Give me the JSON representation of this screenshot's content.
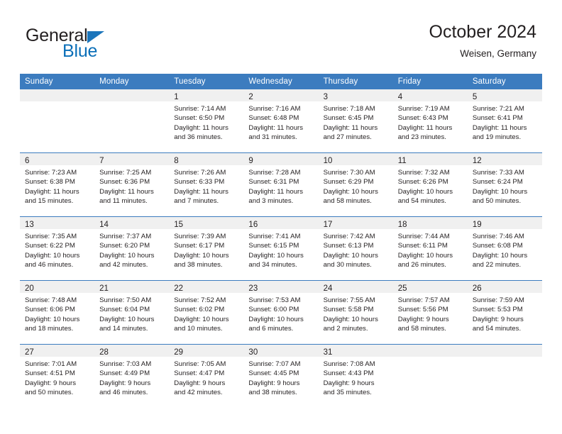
{
  "brand": {
    "name_part1": "General",
    "name_part2": "Blue",
    "accent_color": "#1b75bb",
    "text_color": "#231f20"
  },
  "header": {
    "title": "October 2024",
    "subtitle": "Weisen, Germany",
    "band_color": "#3c7cbf",
    "daynum_band_color": "#f0f0f0"
  },
  "weekday_headers": [
    "Sunday",
    "Monday",
    "Tuesday",
    "Wednesday",
    "Thursday",
    "Friday",
    "Saturday"
  ],
  "labels": {
    "sunrise_prefix": "Sunrise:",
    "sunset_prefix": "Sunset:",
    "daylight_prefix": "Daylight:"
  },
  "weeks": [
    [
      {
        "day": "",
        "empty": true,
        "sunrise": "",
        "sunset": "",
        "daylight_line1": "",
        "daylight_line2": ""
      },
      {
        "day": "",
        "empty": true,
        "sunrise": "",
        "sunset": "",
        "daylight_line1": "",
        "daylight_line2": ""
      },
      {
        "day": "1",
        "empty": false,
        "sunrise": "Sunrise: 7:14 AM",
        "sunset": "Sunset: 6:50 PM",
        "daylight_line1": "Daylight: 11 hours",
        "daylight_line2": "and 36 minutes."
      },
      {
        "day": "2",
        "empty": false,
        "sunrise": "Sunrise: 7:16 AM",
        "sunset": "Sunset: 6:48 PM",
        "daylight_line1": "Daylight: 11 hours",
        "daylight_line2": "and 31 minutes."
      },
      {
        "day": "3",
        "empty": false,
        "sunrise": "Sunrise: 7:18 AM",
        "sunset": "Sunset: 6:45 PM",
        "daylight_line1": "Daylight: 11 hours",
        "daylight_line2": "and 27 minutes."
      },
      {
        "day": "4",
        "empty": false,
        "sunrise": "Sunrise: 7:19 AM",
        "sunset": "Sunset: 6:43 PM",
        "daylight_line1": "Daylight: 11 hours",
        "daylight_line2": "and 23 minutes."
      },
      {
        "day": "5",
        "empty": false,
        "sunrise": "Sunrise: 7:21 AM",
        "sunset": "Sunset: 6:41 PM",
        "daylight_line1": "Daylight: 11 hours",
        "daylight_line2": "and 19 minutes."
      }
    ],
    [
      {
        "day": "6",
        "empty": false,
        "sunrise": "Sunrise: 7:23 AM",
        "sunset": "Sunset: 6:38 PM",
        "daylight_line1": "Daylight: 11 hours",
        "daylight_line2": "and 15 minutes."
      },
      {
        "day": "7",
        "empty": false,
        "sunrise": "Sunrise: 7:25 AM",
        "sunset": "Sunset: 6:36 PM",
        "daylight_line1": "Daylight: 11 hours",
        "daylight_line2": "and 11 minutes."
      },
      {
        "day": "8",
        "empty": false,
        "sunrise": "Sunrise: 7:26 AM",
        "sunset": "Sunset: 6:33 PM",
        "daylight_line1": "Daylight: 11 hours",
        "daylight_line2": "and 7 minutes."
      },
      {
        "day": "9",
        "empty": false,
        "sunrise": "Sunrise: 7:28 AM",
        "sunset": "Sunset: 6:31 PM",
        "daylight_line1": "Daylight: 11 hours",
        "daylight_line2": "and 3 minutes."
      },
      {
        "day": "10",
        "empty": false,
        "sunrise": "Sunrise: 7:30 AM",
        "sunset": "Sunset: 6:29 PM",
        "daylight_line1": "Daylight: 10 hours",
        "daylight_line2": "and 58 minutes."
      },
      {
        "day": "11",
        "empty": false,
        "sunrise": "Sunrise: 7:32 AM",
        "sunset": "Sunset: 6:26 PM",
        "daylight_line1": "Daylight: 10 hours",
        "daylight_line2": "and 54 minutes."
      },
      {
        "day": "12",
        "empty": false,
        "sunrise": "Sunrise: 7:33 AM",
        "sunset": "Sunset: 6:24 PM",
        "daylight_line1": "Daylight: 10 hours",
        "daylight_line2": "and 50 minutes."
      }
    ],
    [
      {
        "day": "13",
        "empty": false,
        "sunrise": "Sunrise: 7:35 AM",
        "sunset": "Sunset: 6:22 PM",
        "daylight_line1": "Daylight: 10 hours",
        "daylight_line2": "and 46 minutes."
      },
      {
        "day": "14",
        "empty": false,
        "sunrise": "Sunrise: 7:37 AM",
        "sunset": "Sunset: 6:20 PM",
        "daylight_line1": "Daylight: 10 hours",
        "daylight_line2": "and 42 minutes."
      },
      {
        "day": "15",
        "empty": false,
        "sunrise": "Sunrise: 7:39 AM",
        "sunset": "Sunset: 6:17 PM",
        "daylight_line1": "Daylight: 10 hours",
        "daylight_line2": "and 38 minutes."
      },
      {
        "day": "16",
        "empty": false,
        "sunrise": "Sunrise: 7:41 AM",
        "sunset": "Sunset: 6:15 PM",
        "daylight_line1": "Daylight: 10 hours",
        "daylight_line2": "and 34 minutes."
      },
      {
        "day": "17",
        "empty": false,
        "sunrise": "Sunrise: 7:42 AM",
        "sunset": "Sunset: 6:13 PM",
        "daylight_line1": "Daylight: 10 hours",
        "daylight_line2": "and 30 minutes."
      },
      {
        "day": "18",
        "empty": false,
        "sunrise": "Sunrise: 7:44 AM",
        "sunset": "Sunset: 6:11 PM",
        "daylight_line1": "Daylight: 10 hours",
        "daylight_line2": "and 26 minutes."
      },
      {
        "day": "19",
        "empty": false,
        "sunrise": "Sunrise: 7:46 AM",
        "sunset": "Sunset: 6:08 PM",
        "daylight_line1": "Daylight: 10 hours",
        "daylight_line2": "and 22 minutes."
      }
    ],
    [
      {
        "day": "20",
        "empty": false,
        "sunrise": "Sunrise: 7:48 AM",
        "sunset": "Sunset: 6:06 PM",
        "daylight_line1": "Daylight: 10 hours",
        "daylight_line2": "and 18 minutes."
      },
      {
        "day": "21",
        "empty": false,
        "sunrise": "Sunrise: 7:50 AM",
        "sunset": "Sunset: 6:04 PM",
        "daylight_line1": "Daylight: 10 hours",
        "daylight_line2": "and 14 minutes."
      },
      {
        "day": "22",
        "empty": false,
        "sunrise": "Sunrise: 7:52 AM",
        "sunset": "Sunset: 6:02 PM",
        "daylight_line1": "Daylight: 10 hours",
        "daylight_line2": "and 10 minutes."
      },
      {
        "day": "23",
        "empty": false,
        "sunrise": "Sunrise: 7:53 AM",
        "sunset": "Sunset: 6:00 PM",
        "daylight_line1": "Daylight: 10 hours",
        "daylight_line2": "and 6 minutes."
      },
      {
        "day": "24",
        "empty": false,
        "sunrise": "Sunrise: 7:55 AM",
        "sunset": "Sunset: 5:58 PM",
        "daylight_line1": "Daylight: 10 hours",
        "daylight_line2": "and 2 minutes."
      },
      {
        "day": "25",
        "empty": false,
        "sunrise": "Sunrise: 7:57 AM",
        "sunset": "Sunset: 5:56 PM",
        "daylight_line1": "Daylight: 9 hours",
        "daylight_line2": "and 58 minutes."
      },
      {
        "day": "26",
        "empty": false,
        "sunrise": "Sunrise: 7:59 AM",
        "sunset": "Sunset: 5:53 PM",
        "daylight_line1": "Daylight: 9 hours",
        "daylight_line2": "and 54 minutes."
      }
    ],
    [
      {
        "day": "27",
        "empty": false,
        "sunrise": "Sunrise: 7:01 AM",
        "sunset": "Sunset: 4:51 PM",
        "daylight_line1": "Daylight: 9 hours",
        "daylight_line2": "and 50 minutes."
      },
      {
        "day": "28",
        "empty": false,
        "sunrise": "Sunrise: 7:03 AM",
        "sunset": "Sunset: 4:49 PM",
        "daylight_line1": "Daylight: 9 hours",
        "daylight_line2": "and 46 minutes."
      },
      {
        "day": "29",
        "empty": false,
        "sunrise": "Sunrise: 7:05 AM",
        "sunset": "Sunset: 4:47 PM",
        "daylight_line1": "Daylight: 9 hours",
        "daylight_line2": "and 42 minutes."
      },
      {
        "day": "30",
        "empty": false,
        "sunrise": "Sunrise: 7:07 AM",
        "sunset": "Sunset: 4:45 PM",
        "daylight_line1": "Daylight: 9 hours",
        "daylight_line2": "and 38 minutes."
      },
      {
        "day": "31",
        "empty": false,
        "sunrise": "Sunrise: 7:08 AM",
        "sunset": "Sunset: 4:43 PM",
        "daylight_line1": "Daylight: 9 hours",
        "daylight_line2": "and 35 minutes."
      },
      {
        "day": "",
        "empty": true,
        "sunrise": "",
        "sunset": "",
        "daylight_line1": "",
        "daylight_line2": ""
      },
      {
        "day": "",
        "empty": true,
        "sunrise": "",
        "sunset": "",
        "daylight_line1": "",
        "daylight_line2": ""
      }
    ]
  ]
}
